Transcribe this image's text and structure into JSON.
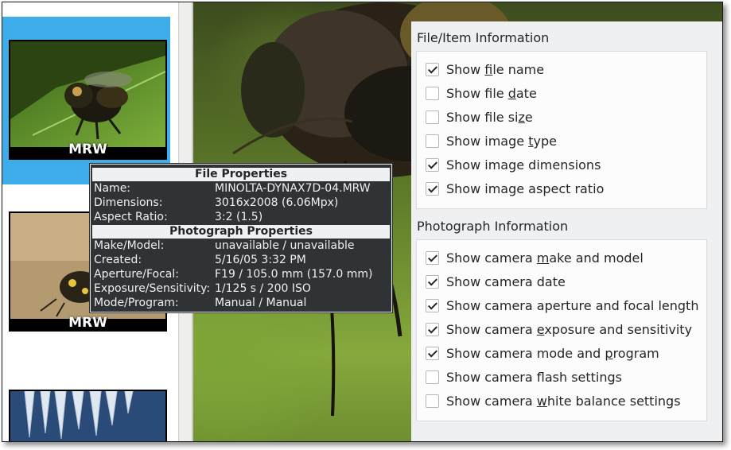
{
  "thumbnails": [
    {
      "caption": "MRW",
      "selected": true
    },
    {
      "caption": "MRW",
      "selected": false
    },
    {
      "caption": "",
      "selected": false
    }
  ],
  "tooltip": {
    "file_heading": "File Properties",
    "file_rows": [
      {
        "key": "Name:",
        "value": "MINOLTA-DYNAX7D-04.MRW"
      },
      {
        "key": "Dimensions:",
        "value": "3016x2008 (6.06Mpx)"
      },
      {
        "key": "Aspect Ratio:",
        "value": "3:2 (1.5)"
      }
    ],
    "photo_heading": "Photograph Properties",
    "photo_rows": [
      {
        "key": "Make/Model:",
        "value": "unavailable / unavailable"
      },
      {
        "key": "Created:",
        "value": "5/16/05 3:32 PM"
      },
      {
        "key": "Aperture/Focal:",
        "value": "F19 / 105.0 mm (157.0 mm)"
      },
      {
        "key": "Exposure/Sensitivity:",
        "value": "1/125 s / 200 ISO"
      },
      {
        "key": "Mode/Program:",
        "value": "Manual / Manual"
      }
    ]
  },
  "panel": {
    "file_group_title": "File/Item Information",
    "file_options": [
      {
        "pre": "Show ",
        "u": "f",
        "post": "ile name",
        "checked": true
      },
      {
        "pre": "Show file ",
        "u": "d",
        "post": "ate",
        "checked": false
      },
      {
        "pre": "Show file si",
        "u": "z",
        "post": "e",
        "checked": false
      },
      {
        "pre": "Show image ",
        "u": "t",
        "post": "ype",
        "checked": false
      },
      {
        "pre": "Show image dimensions",
        "u": "",
        "post": "",
        "checked": true
      },
      {
        "pre": "Show image aspect ratio",
        "u": "",
        "post": "",
        "checked": true
      }
    ],
    "photo_group_title": "Photograph Information",
    "photo_options": [
      {
        "pre": "Show camera ",
        "u": "m",
        "post": "ake and model",
        "checked": true
      },
      {
        "pre": "Show camera date",
        "u": "",
        "post": "",
        "checked": true
      },
      {
        "pre": "Show camera aperture and focal length",
        "u": "",
        "post": "",
        "checked": true
      },
      {
        "pre": "Show camera ",
        "u": "e",
        "post": "xposure and sensitivity",
        "checked": true
      },
      {
        "pre": "Show camera mode and ",
        "u": "p",
        "post": "rogram",
        "checked": true
      },
      {
        "pre": "Show camera flash settings",
        "u": "",
        "post": "",
        "checked": false
      },
      {
        "pre": "Show camera ",
        "u": "w",
        "post": "hite balance settings",
        "checked": false
      }
    ]
  }
}
